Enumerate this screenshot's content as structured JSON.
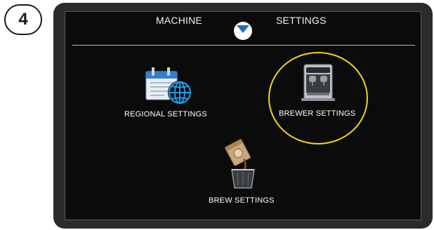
{
  "step": {
    "number": "4"
  },
  "header": {
    "machine_label": "MACHINE",
    "settings_label": "SETTINGS",
    "mode_icon": "toggle-indicator-icon"
  },
  "menu": {
    "items": [
      {
        "label": "REGIONAL SETTINGS",
        "icon": "calendar-globe-icon"
      },
      {
        "label": "BREWER SETTINGS",
        "icon": "brewer-machine-icon",
        "highlighted": true
      },
      {
        "label": "BREW SETTINGS",
        "icon": "coffee-bag-pour-icon"
      }
    ]
  },
  "colors": {
    "screen_bg": "#0b0b0b",
    "bezel": "#2b2b2b",
    "highlight": "#f2d51a",
    "accent_blue": "#1e90d6"
  }
}
